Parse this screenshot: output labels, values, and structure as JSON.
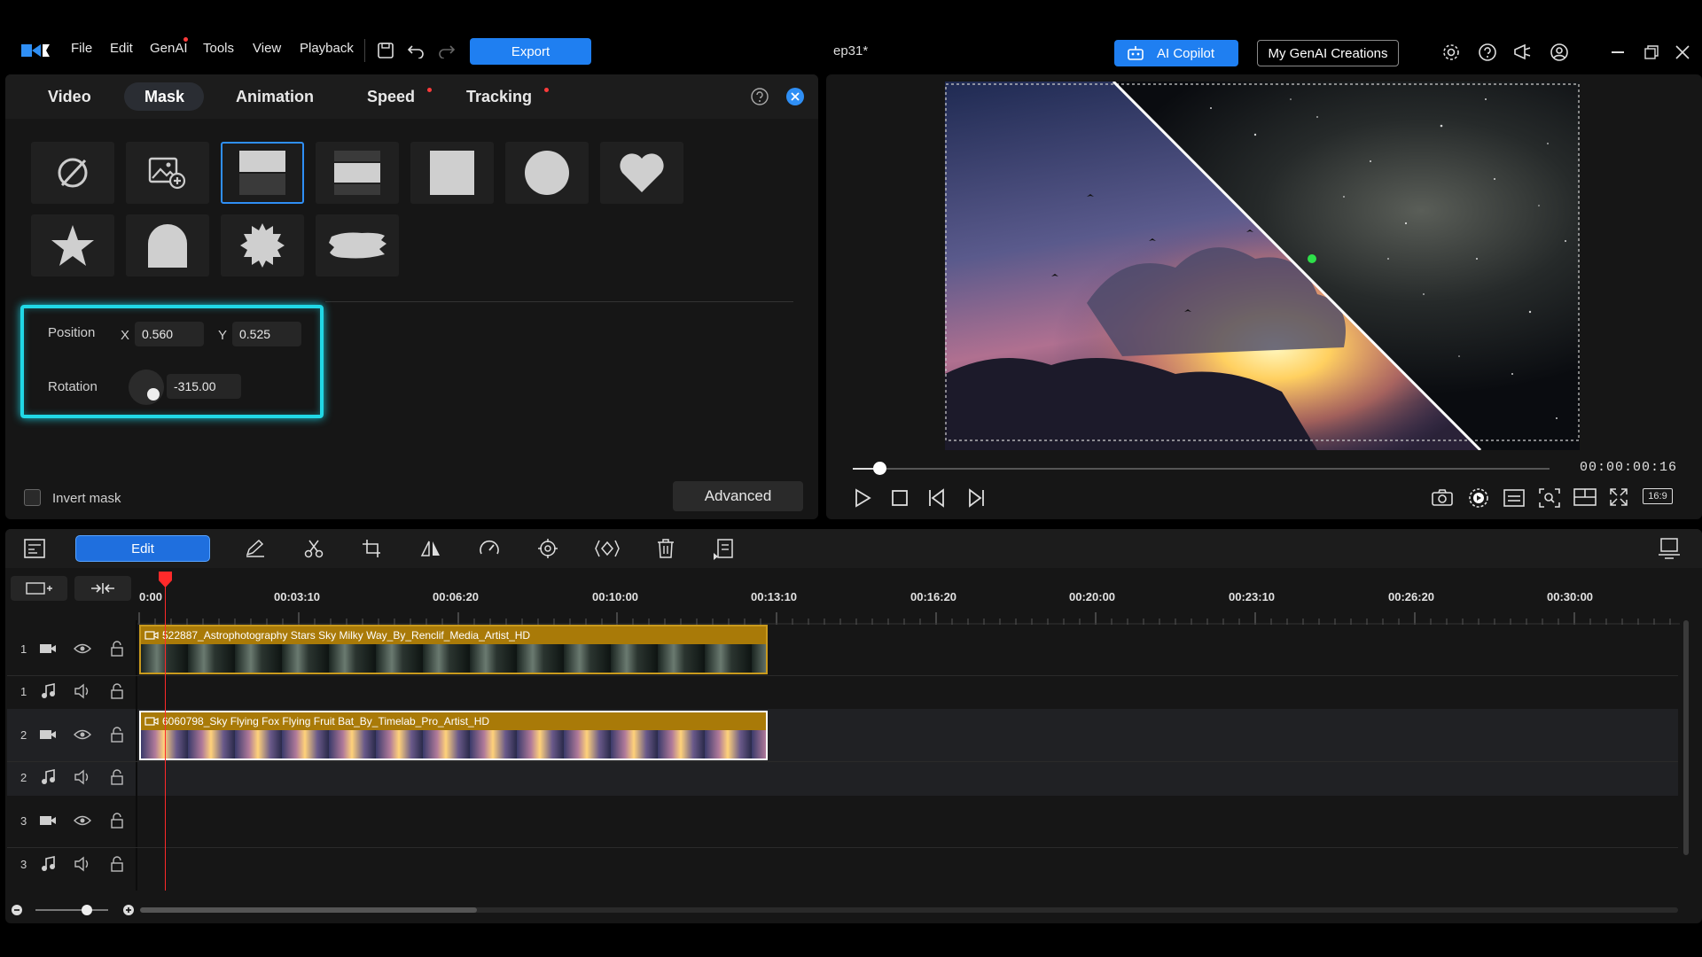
{
  "titlebar": {
    "menu": [
      "File",
      "Edit",
      "GenAI",
      "Tools",
      "View",
      "Playback"
    ],
    "export_label": "Export",
    "document_title": "ep31*",
    "ai_copilot_label": "AI Copilot",
    "my_genai_label": "My GenAI Creations"
  },
  "mask_panel": {
    "tabs": [
      "Video",
      "Mask",
      "Animation",
      "Speed",
      "Tracking"
    ],
    "active_tab": "Mask",
    "shapes": [
      "none",
      "image-mask",
      "linear-top",
      "linear-band",
      "rectangle",
      "circle",
      "heart",
      "star",
      "arch",
      "starburst",
      "brush"
    ],
    "selected_shape": "linear-top",
    "position_label": "Position",
    "x_label": "X",
    "x_value": "0.560",
    "y_label": "Y",
    "y_value": "0.525",
    "rotation_label": "Rotation",
    "rotation_value": "-315.00",
    "invert_mask_label": "Invert mask",
    "advanced_label": "Advanced"
  },
  "preview": {
    "timecode": "00:00:00:16",
    "playhead_progress": 0.04,
    "aspect_label": "16:9"
  },
  "timeline": {
    "edit_label": "Edit",
    "ruler": [
      "0:00",
      "00:03:10",
      "00:06:20",
      "00:10:00",
      "00:13:10",
      "00:16:20",
      "00:20:00",
      "00:23:10",
      "00:26:20",
      "00:30:00"
    ],
    "tracks": [
      {
        "num": "1",
        "kind": "video"
      },
      {
        "num": "1",
        "kind": "audio"
      },
      {
        "num": "2",
        "kind": "video"
      },
      {
        "num": "2",
        "kind": "audio"
      },
      {
        "num": "3",
        "kind": "video"
      },
      {
        "num": "3",
        "kind": "audio"
      }
    ],
    "clips": [
      {
        "title": "522887_Astrophotography Stars Sky Milky Way_By_Renclif_Media_Artist_HD"
      },
      {
        "title": "6060798_Sky Flying Fox Flying Fruit Bat_By_Timelab_Pro_Artist_HD"
      }
    ]
  },
  "colors": {
    "accent": "#1f7ff1",
    "highlight": "#21d8e6",
    "clip": "#a97a08",
    "playhead": "#ff2a2a"
  }
}
